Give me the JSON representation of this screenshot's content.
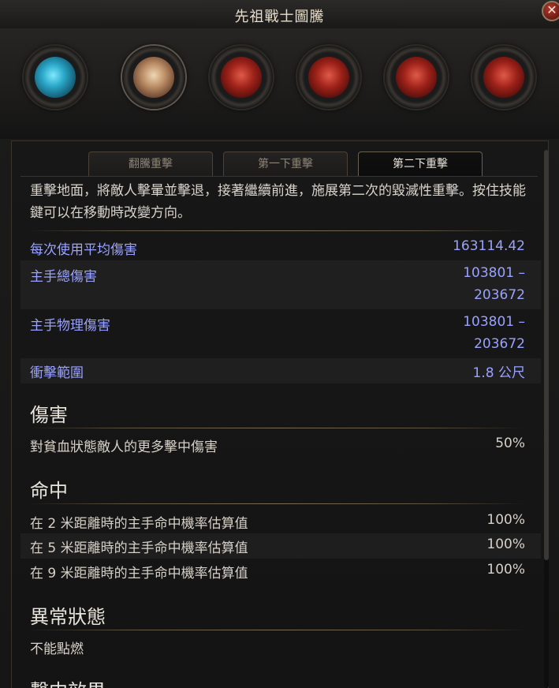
{
  "window": {
    "title": "先祖戰士圖騰",
    "close_symbol": "✕"
  },
  "skills": [
    {
      "icon": "blue-orb-icon",
      "color": "#2aa7c8"
    },
    {
      "icon": "tan-orb-icon",
      "color": "#b88a63"
    },
    {
      "icon": "red-orb-icon",
      "color": "#a0231a"
    },
    {
      "icon": "red-orb-icon",
      "color": "#a0231a"
    },
    {
      "icon": "red-orb-icon",
      "color": "#a0231a"
    },
    {
      "icon": "red-orb-icon",
      "color": "#a0231a"
    }
  ],
  "tabs": [
    {
      "label": "翻騰重擊"
    },
    {
      "label": "第一下重擊"
    },
    {
      "label": "第二下重擊"
    }
  ],
  "description": "重擊地面，將敵人擊暈並擊退，接著繼續前進，施展第二次的毀滅性重擊。按住技能鍵可以在移動時改變方向。",
  "stats": [
    {
      "label": "每次使用平均傷害",
      "value": "163114.42"
    },
    {
      "label": "主手總傷害",
      "value_line1": "103801 –",
      "value_line2": "203672"
    },
    {
      "label": "主手物理傷害",
      "value_line1": "103801 –",
      "value_line2": "203672"
    },
    {
      "label": "衝擊範圍",
      "value": "1.8 公尺"
    }
  ],
  "sections": {
    "damage": {
      "title": "傷害",
      "rows": [
        {
          "label": "對貧血狀態敵人的更多擊中傷害",
          "value": "50%"
        }
      ]
    },
    "hit": {
      "title": "命中",
      "rows": [
        {
          "label": "在 2 米距離時的主手命中機率估算值",
          "value": "100%"
        },
        {
          "label": "在 5 米距離時的主手命中機率估算值",
          "value": "100%"
        },
        {
          "label": "在 9 米距離時的主手命中機率估算值",
          "value": "100%"
        }
      ]
    },
    "status": {
      "title": "異常狀態",
      "text": "不能點燃"
    },
    "next": {
      "title": "擊中效果"
    }
  },
  "colors": {
    "stat_text": "#9aa2ff",
    "body_text": "#d6d1c8",
    "background": "#161616"
  }
}
